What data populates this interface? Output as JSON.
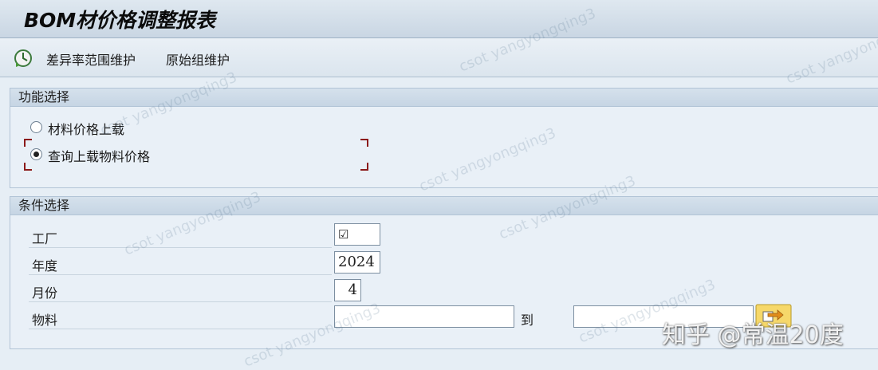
{
  "window": {
    "title": "BOM材价格调整报表"
  },
  "toolbar": {
    "buttons": [
      "差异率范围维护",
      "原始组维护"
    ]
  },
  "function_group": {
    "title": "功能选择",
    "options": [
      {
        "label": "材料价格上载",
        "selected": false
      },
      {
        "label": "查询上载物料价格",
        "selected": true
      }
    ]
  },
  "condition_group": {
    "title": "条件选择",
    "rows": [
      {
        "label": "工厂",
        "value": "☑"
      },
      {
        "label": "年度",
        "value": "2024"
      },
      {
        "label": "月份",
        "value": "4"
      },
      {
        "label": "物料",
        "value": "",
        "to_label": "到",
        "to_value": ""
      }
    ]
  },
  "watermarks": [
    "csot yangyongqing3"
  ],
  "corner_watermark": "知乎 @常温20度",
  "colors": {
    "title_bar": "#c9d6e3",
    "group_head": "#c6d5e4",
    "focus_frame": "#8b1a1a",
    "range_button": "#f6d86a"
  }
}
